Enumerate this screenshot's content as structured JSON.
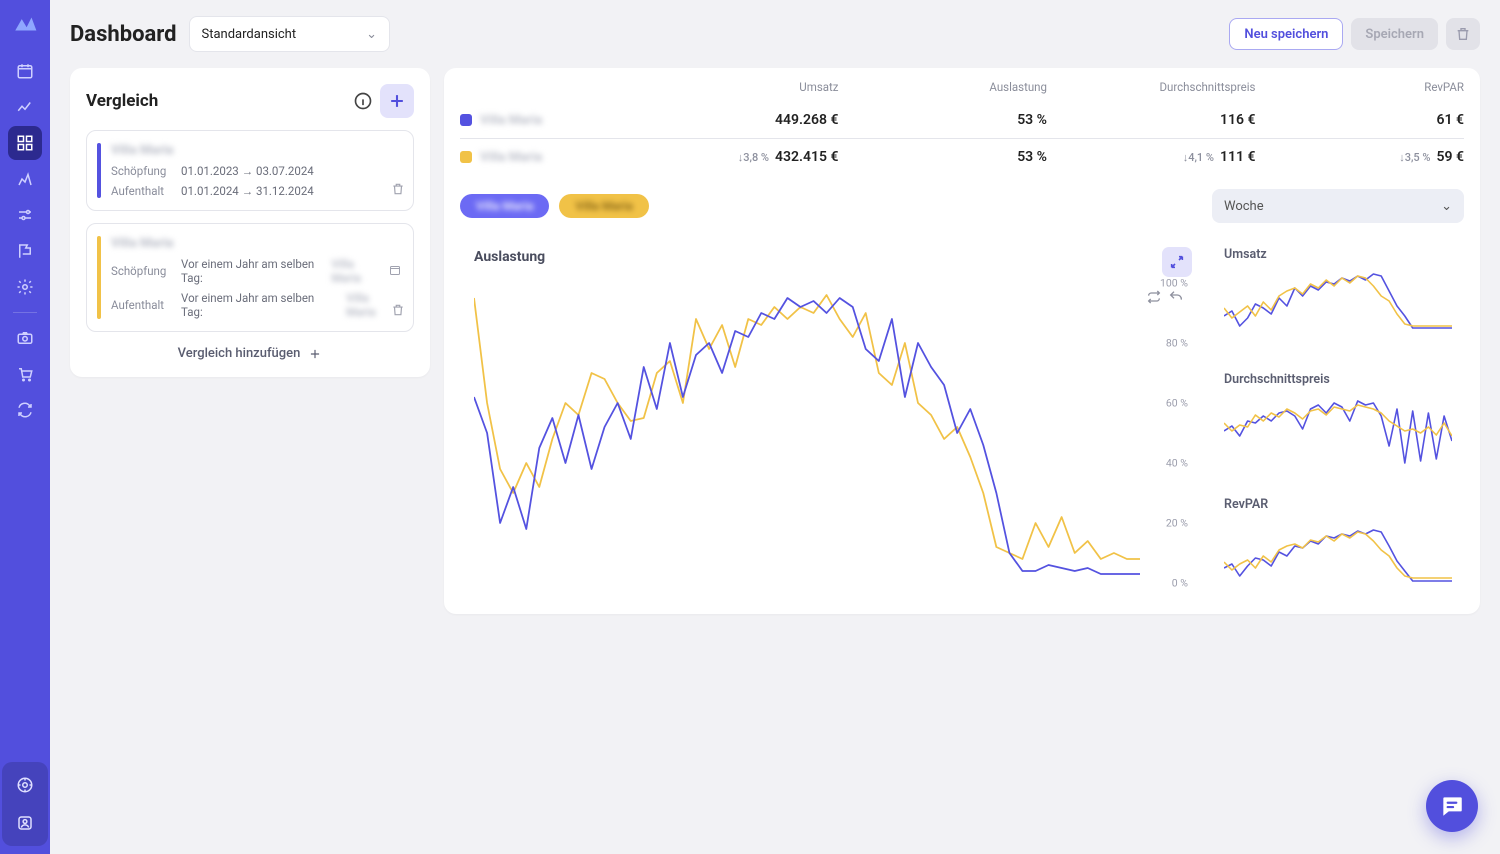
{
  "page": {
    "title": "Dashboard"
  },
  "view_select": {
    "label": "Standardansicht"
  },
  "toolbar": {
    "save_new": "Neu speichern",
    "save": "Speichern"
  },
  "compare": {
    "title": "Vergleich",
    "add_label": "Vergleich hinzufügen",
    "cards": [
      {
        "name": "Villa Maria",
        "creation_label": "Schöpfung",
        "creation_value": "01.01.2023  →  03.07.2024",
        "stay_label": "Aufenthalt",
        "stay_value": "01.01.2024  →  31.12.2024"
      },
      {
        "name": "Villa Maria",
        "creation_label": "Schöpfung",
        "creation_prefix": "Vor einem Jahr am selben Tag:",
        "creation_ref": "Villa Maria",
        "stay_label": "Aufenthalt",
        "stay_prefix": "Vor einem Jahr am selben Tag:",
        "stay_ref": "Villa Maria"
      }
    ]
  },
  "summary": {
    "headers": {
      "umsatz": "Umsatz",
      "auslastung": "Auslastung",
      "adr": "Durchschnittspreis",
      "revpar": "RevPAR"
    },
    "rows": [
      {
        "name": "Villa Maria",
        "umsatz": "449.268 €",
        "auslastung": "53 %",
        "adr": "116 €",
        "revpar": "61 €"
      },
      {
        "name": "Villa Maria",
        "umsatz": "432.415 €",
        "umsatz_delta": "3,8 %",
        "auslastung": "53 %",
        "adr": "111 €",
        "adr_delta": "4,1 %",
        "revpar": "59 €",
        "revpar_delta": "3,5 %"
      }
    ]
  },
  "pills": {
    "blue": "Villa Maria",
    "yellow": "Villa Maria"
  },
  "period": {
    "label": "Woche"
  },
  "big_chart": {
    "title": "Auslastung"
  },
  "mini": {
    "umsatz": "Umsatz",
    "adr": "Durchschnittspreis",
    "revpar": "RevPAR"
  },
  "chart_data": {
    "main": {
      "type": "line",
      "title": "Auslastung",
      "ylabel": "%",
      "ylim": [
        0,
        100
      ],
      "yticks": [
        "0 %",
        "20 %",
        "40 %",
        "60 %",
        "80 %",
        "100 %"
      ],
      "xrange_weeks": [
        1,
        52
      ],
      "series": [
        {
          "name": "series_blue",
          "color": "#5452e0",
          "values": [
            62,
            50,
            20,
            32,
            18,
            45,
            55,
            40,
            56,
            38,
            52,
            60,
            48,
            72,
            58,
            80,
            62,
            76,
            80,
            70,
            84,
            82,
            90,
            88,
            95,
            92,
            94,
            90,
            95,
            92,
            78,
            74,
            88,
            62,
            80,
            72,
            66,
            50,
            58,
            46,
            30,
            10,
            4,
            4,
            6,
            5,
            4,
            5,
            3,
            3,
            3,
            3
          ]
        },
        {
          "name": "series_yellow",
          "color": "#f1c247",
          "values": [
            95,
            60,
            38,
            30,
            40,
            32,
            48,
            60,
            56,
            70,
            68,
            60,
            54,
            55,
            70,
            74,
            60,
            88,
            78,
            86,
            72,
            88,
            86,
            92,
            88,
            92,
            90,
            96,
            88,
            82,
            90,
            70,
            66,
            80,
            60,
            56,
            48,
            52,
            42,
            30,
            12,
            10,
            8,
            20,
            12,
            22,
            10,
            14,
            8,
            10,
            8,
            8
          ]
        }
      ]
    },
    "mini_umsatz": {
      "type": "line",
      "series": [
        {
          "color": "#5452e0",
          "values": [
            30,
            35,
            20,
            28,
            42,
            38,
            32,
            48,
            40,
            58,
            50,
            60,
            56,
            64,
            62,
            68,
            65,
            70,
            66,
            72,
            70,
            55,
            40,
            30,
            18,
            18,
            18,
            18,
            18,
            18
          ]
        },
        {
          "color": "#f1c247",
          "values": [
            38,
            28,
            34,
            40,
            30,
            44,
            36,
            50,
            55,
            58,
            52,
            62,
            58,
            66,
            60,
            68,
            63,
            70,
            68,
            60,
            50,
            45,
            32,
            22,
            20,
            20,
            20,
            20,
            20,
            20
          ]
        }
      ]
    },
    "mini_adr": {
      "type": "line",
      "series": [
        {
          "color": "#5452e0",
          "values": [
            40,
            45,
            35,
            50,
            48,
            55,
            50,
            58,
            60,
            55,
            42,
            62,
            66,
            58,
            68,
            64,
            50,
            70,
            66,
            68,
            55,
            25,
            62,
            8,
            60,
            10,
            58,
            12,
            55,
            30
          ]
        },
        {
          "color": "#f1c247",
          "values": [
            48,
            40,
            46,
            44,
            56,
            50,
            58,
            54,
            62,
            58,
            52,
            60,
            62,
            56,
            64,
            62,
            60,
            66,
            64,
            62,
            58,
            50,
            45,
            40,
            42,
            38,
            44,
            36,
            48,
            35
          ]
        }
      ]
    },
    "mini_revpar": {
      "type": "line",
      "series": [
        {
          "color": "#5452e0",
          "values": [
            28,
            32,
            20,
            30,
            38,
            36,
            30,
            44,
            40,
            50,
            48,
            55,
            52,
            60,
            58,
            62,
            60,
            65,
            62,
            66,
            64,
            50,
            35,
            25,
            15,
            15,
            15,
            15,
            15,
            15
          ]
        },
        {
          "color": "#f1c247",
          "values": [
            34,
            26,
            32,
            36,
            28,
            40,
            34,
            46,
            50,
            52,
            48,
            56,
            54,
            60,
            55,
            62,
            58,
            64,
            62,
            55,
            46,
            40,
            28,
            20,
            18,
            18,
            18,
            18,
            18,
            18
          ]
        }
      ]
    }
  }
}
